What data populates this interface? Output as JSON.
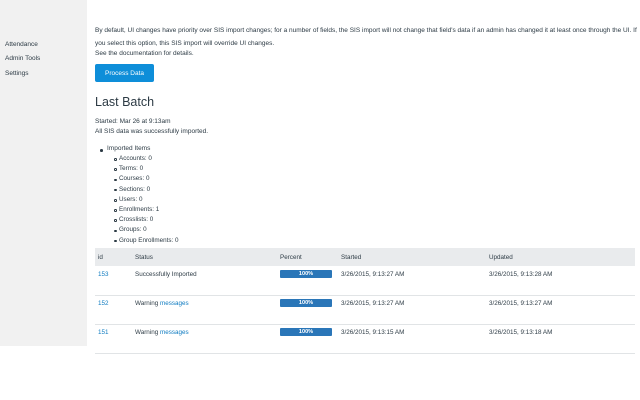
{
  "sidebar": {
    "items": [
      {
        "label": "Attendance"
      },
      {
        "label": "Admin Tools"
      },
      {
        "label": "Settings"
      }
    ]
  },
  "intro": {
    "line1": "By default, UI changes have priority over SIS import changes; for a number of fields, the SIS import will not change that field's data if an admin has changed it at least once through the UI. If",
    "line2": "you select this option, this SIS import will override UI changes.",
    "line3": "See the documentation for details."
  },
  "process_button": {
    "label": "Process Data"
  },
  "last_batch": {
    "title": "Last Batch",
    "started": "Started: Mar 26 at 9:13am",
    "status_message": "All SIS data was successfully imported.",
    "imported_heading": "Imported Items",
    "items": [
      {
        "label": "Accounts: 0"
      },
      {
        "label": "Terms: 0"
      },
      {
        "label": "Courses: 0"
      },
      {
        "label": "Sections: 0"
      },
      {
        "label": "Users: 0"
      },
      {
        "label": "Enrollments: 1"
      },
      {
        "label": "Crosslists: 0"
      },
      {
        "label": "Groups: 0"
      },
      {
        "label": "Group Enrollments: 0"
      }
    ]
  },
  "table": {
    "headers": {
      "id": "id",
      "status": "Status",
      "percent": "Percent",
      "started": "Started",
      "updated": "Updated"
    },
    "rows": [
      {
        "id": "153",
        "status": "Successfully Imported",
        "status_link": "",
        "percent": 1.0,
        "percent_label": "100%",
        "started": "3/26/2015, 9:13:27 AM",
        "updated": "3/26/2015, 9:13:28 AM"
      },
      {
        "id": "152",
        "status": "Warning",
        "status_link": "messages",
        "percent": 1.0,
        "percent_label": "100%",
        "started": "3/26/2015, 9:13:27 AM",
        "updated": "3/26/2015, 9:13:27 AM"
      },
      {
        "id": "151",
        "status": "Warning",
        "status_link": "messages",
        "percent": 1.0,
        "percent_label": "100%",
        "started": "3/26/2015, 9:13:15 AM",
        "updated": "3/26/2015, 9:13:18 AM"
      }
    ]
  },
  "colors": {
    "accent": "#0e8ed9",
    "progress": "#2a76b8",
    "link": "#0e7bc1",
    "sidebar_bg": "#f1f1f1",
    "table_header_bg": "#e9ebed"
  }
}
